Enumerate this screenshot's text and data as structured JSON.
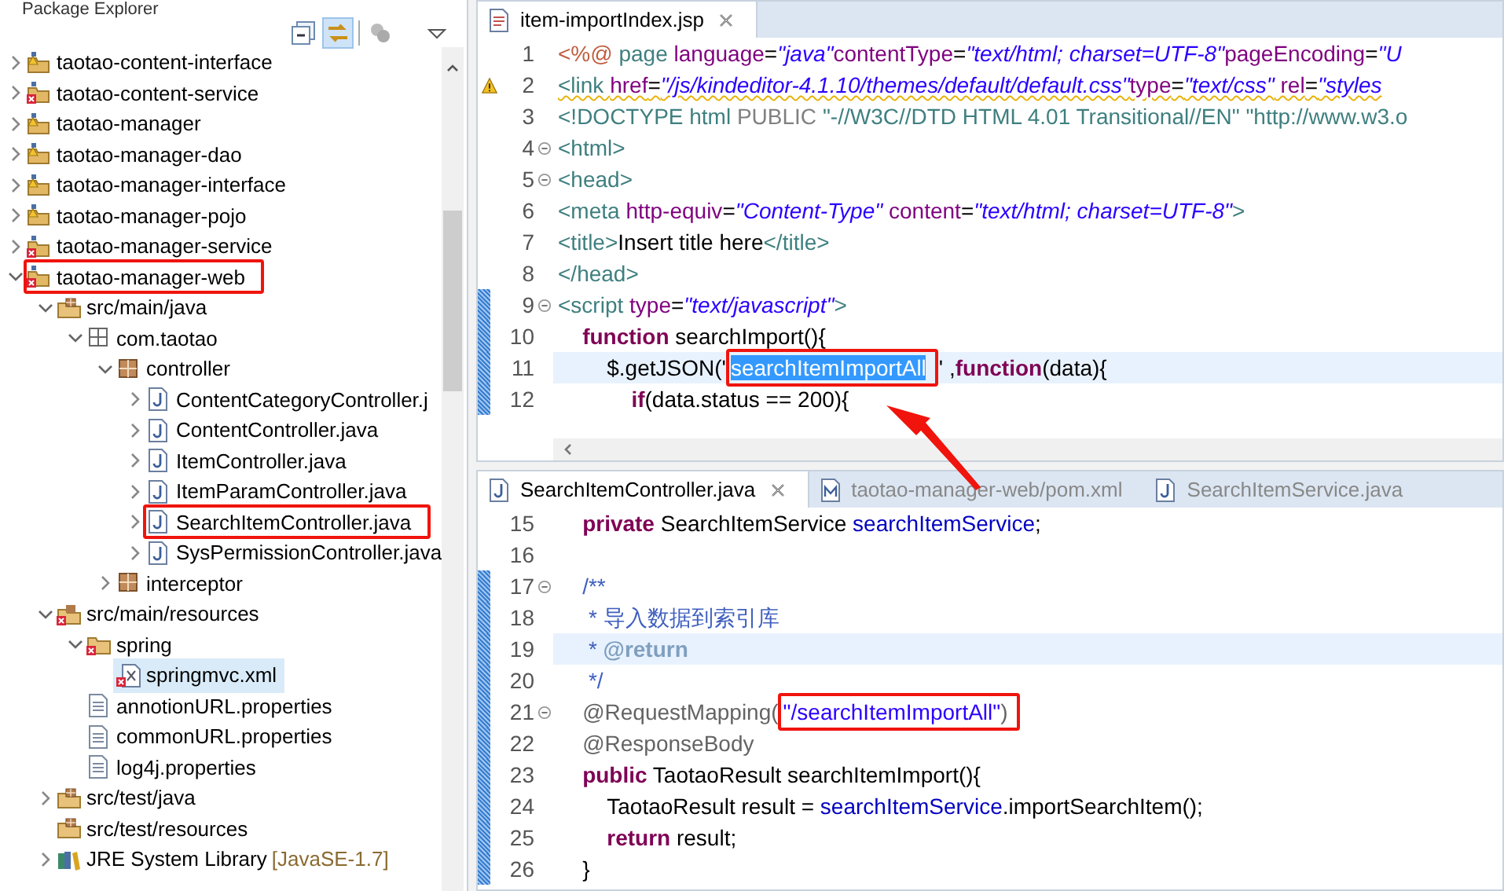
{
  "explorer": {
    "title": "Package Explorer",
    "tree": [
      {
        "label": "taotao-content-interface",
        "kind": "project-warning",
        "expanded": false,
        "selected": false
      },
      {
        "label": "taotao-content-service",
        "kind": "project-error",
        "expanded": false,
        "selected": false
      },
      {
        "label": "taotao-manager",
        "kind": "project-warning",
        "expanded": false,
        "selected": false
      },
      {
        "label": "taotao-manager-dao",
        "kind": "project-warning",
        "expanded": false,
        "selected": false
      },
      {
        "label": "taotao-manager-interface",
        "kind": "project-warning",
        "expanded": false,
        "selected": false
      },
      {
        "label": "taotao-manager-pojo",
        "kind": "project-warning",
        "expanded": false,
        "selected": false
      },
      {
        "label": "taotao-manager-service",
        "kind": "project-error",
        "expanded": false,
        "selected": false
      },
      {
        "label": "taotao-manager-web",
        "kind": "project-error",
        "expanded": true,
        "selected": false,
        "marked": true,
        "children": [
          {
            "label": "src/main/java",
            "kind": "source-folder",
            "expanded": true,
            "selected": false,
            "children": [
              {
                "label": "com.taotao",
                "kind": "package-empty",
                "expanded": true,
                "selected": false,
                "children": [
                  {
                    "label": "controller",
                    "kind": "package",
                    "expanded": true,
                    "selected": false,
                    "children": [
                      {
                        "label": "ContentCategoryController.j",
                        "kind": "java",
                        "expanded": false,
                        "selected": false
                      },
                      {
                        "label": "ContentController.java",
                        "kind": "java",
                        "expanded": false,
                        "selected": false
                      },
                      {
                        "label": "ItemController.java",
                        "kind": "java",
                        "expanded": false,
                        "selected": false
                      },
                      {
                        "label": "ItemParamController.java",
                        "kind": "java",
                        "expanded": false,
                        "selected": false
                      },
                      {
                        "label": "SearchItemController.java",
                        "kind": "java",
                        "expanded": false,
                        "selected": false,
                        "marked": true
                      },
                      {
                        "label": "SysPermissionController.java",
                        "kind": "java",
                        "expanded": false,
                        "selected": false
                      }
                    ]
                  },
                  {
                    "label": "interceptor",
                    "kind": "package",
                    "expanded": false,
                    "selected": false
                  }
                ]
              }
            ]
          },
          {
            "label": "src/main/resources",
            "kind": "source-folder-error",
            "expanded": true,
            "selected": false,
            "children": [
              {
                "label": "spring",
                "kind": "folder-error",
                "expanded": true,
                "selected": false,
                "children": [
                  {
                    "label": "springmvc.xml",
                    "kind": "xml-error",
                    "selected": true
                  }
                ]
              },
              {
                "label": "annotionURL.properties",
                "kind": "properties",
                "selected": false
              },
              {
                "label": "commonURL.properties",
                "kind": "properties",
                "selected": false
              },
              {
                "label": "log4j.properties",
                "kind": "properties",
                "selected": false
              }
            ]
          },
          {
            "label": "src/test/java",
            "kind": "source-folder",
            "expanded": false,
            "selected": false
          },
          {
            "label": "src/test/resources",
            "kind": "source-folder",
            "selected": false
          },
          {
            "label": "JRE System Library",
            "decoration": "[JavaSE-1.7]",
            "kind": "library",
            "expanded": false,
            "selected": false
          }
        ]
      }
    ]
  },
  "editors": [
    {
      "tabs": [
        {
          "label": "item-importIndex.jsp",
          "kind": "jsp",
          "selected": true,
          "closable": true
        }
      ],
      "lines": [
        {
          "number": "1",
          "fold": false,
          "changed": false,
          "current": false,
          "warning": false,
          "tokens": [
            {
              "kind": "jsp",
              "text": "<%@ "
            },
            {
              "kind": "tag",
              "text": "page "
            },
            {
              "kind": "attr",
              "text": "language"
            },
            {
              "kind": "plain",
              "text": "="
            },
            {
              "kind": "string",
              "text": "\"java\""
            },
            {
              "kind": "attr",
              "text": "contentType"
            },
            {
              "kind": "plain",
              "text": "="
            },
            {
              "kind": "string",
              "text": "\"text/html; charset=UTF-8\""
            },
            {
              "kind": "attr",
              "text": "pageEncoding"
            },
            {
              "kind": "plain",
              "text": "="
            },
            {
              "kind": "string",
              "text": "\"U"
            }
          ]
        },
        {
          "number": "2",
          "fold": false,
          "changed": false,
          "current": false,
          "warning": true,
          "tokens": [
            {
              "kind": "tag",
              "text": "<link "
            },
            {
              "kind": "attr",
              "text": "href"
            },
            {
              "kind": "plain",
              "text": "="
            },
            {
              "kind": "string",
              "text": "\"/js/kindeditor-4.1.10/themes/default/default.css\""
            },
            {
              "kind": "attr",
              "text": "type"
            },
            {
              "kind": "plain",
              "text": "="
            },
            {
              "kind": "string",
              "text": "\"text/css\""
            },
            {
              "kind": "attr",
              "text": " rel"
            },
            {
              "kind": "plain",
              "text": "="
            },
            {
              "kind": "string",
              "text": "\"styles"
            }
          ]
        },
        {
          "number": "3",
          "fold": false,
          "changed": false,
          "current": false,
          "warning": false,
          "tokens": [
            {
              "kind": "tag",
              "text": "<!DOCTYPE html "
            },
            {
              "kind": "grey",
              "text": "PUBLIC "
            },
            {
              "kind": "tag",
              "text": "\"-//W3C//DTD HTML 4.01 Transitional//EN\" \"http://www.w3.o"
            }
          ]
        },
        {
          "number": "4",
          "fold": true,
          "changed": false,
          "current": false,
          "warning": false,
          "tokens": [
            {
              "kind": "tag",
              "text": "<html>"
            }
          ]
        },
        {
          "number": "5",
          "fold": true,
          "changed": false,
          "current": false,
          "warning": false,
          "tokens": [
            {
              "kind": "tag",
              "text": "<head>"
            }
          ]
        },
        {
          "number": "6",
          "fold": false,
          "changed": false,
          "current": false,
          "warning": false,
          "tokens": [
            {
              "kind": "tag",
              "text": "<meta "
            },
            {
              "kind": "attr",
              "text": "http-equiv"
            },
            {
              "kind": "plain",
              "text": "="
            },
            {
              "kind": "string",
              "text": "\"Content-Type\""
            },
            {
              "kind": "attr",
              "text": " content"
            },
            {
              "kind": "plain",
              "text": "="
            },
            {
              "kind": "string",
              "text": "\"text/html; charset=UTF-8\""
            },
            {
              "kind": "tag",
              "text": ">"
            }
          ]
        },
        {
          "number": "7",
          "fold": false,
          "changed": false,
          "current": false,
          "warning": false,
          "tokens": [
            {
              "kind": "tag",
              "text": "<title>"
            },
            {
              "kind": "plain",
              "text": "Insert title here"
            },
            {
              "kind": "tag",
              "text": "</title>"
            }
          ]
        },
        {
          "number": "8",
          "fold": false,
          "changed": false,
          "current": false,
          "warning": false,
          "tokens": [
            {
              "kind": "tag",
              "text": "</head>"
            }
          ]
        },
        {
          "number": "9",
          "fold": true,
          "changed": true,
          "current": false,
          "warning": false,
          "tokens": [
            {
              "kind": "tag",
              "text": "<script "
            },
            {
              "kind": "attr",
              "text": "type"
            },
            {
              "kind": "plain",
              "text": "="
            },
            {
              "kind": "string",
              "text": "\"text/javascript\""
            },
            {
              "kind": "tag",
              "text": ">"
            }
          ]
        },
        {
          "number": "10",
          "fold": false,
          "changed": true,
          "current": false,
          "warning": false,
          "tokens": [
            {
              "kind": "keyword",
              "text": "\tfunction"
            },
            {
              "kind": "plain",
              "text": " searchImport(){"
            }
          ]
        },
        {
          "number": "11",
          "fold": false,
          "changed": true,
          "current": true,
          "warning": false,
          "tokens": [
            {
              "kind": "plain",
              "text": "\t\t$.getJSON('"
            },
            {
              "kind": "selection",
              "text": "searchItemImportAll",
              "boxed": true
            },
            {
              "kind": "plain",
              "text": "' ,"
            },
            {
              "kind": "keyword",
              "text": "function"
            },
            {
              "kind": "plain",
              "text": "(data){"
            }
          ]
        },
        {
          "number": "12",
          "fold": false,
          "changed": true,
          "current": false,
          "warning": false,
          "tokens": [
            {
              "kind": "keyword",
              "text": "\t\t\tif"
            },
            {
              "kind": "plain",
              "text": "(data.status == 200){"
            }
          ]
        }
      ]
    },
    {
      "tabs": [
        {
          "label": "SearchItemController.java",
          "kind": "java",
          "selected": true,
          "closable": true
        },
        {
          "label": "taotao-manager-web/pom.xml",
          "kind": "maven",
          "selected": false,
          "closable": false
        },
        {
          "label": "SearchItemService.java",
          "kind": "java",
          "selected": false,
          "closable": false
        }
      ],
      "lines": [
        {
          "number": "15",
          "fold": false,
          "changed": false,
          "current": false,
          "warning": false,
          "tokens": [
            {
              "kind": "keyword",
              "text": "\tprivate"
            },
            {
              "kind": "plain",
              "text": " SearchItemService "
            },
            {
              "kind": "field",
              "text": "searchItemService"
            },
            {
              "kind": "plain",
              "text": ";"
            }
          ]
        },
        {
          "number": "16",
          "fold": false,
          "changed": false,
          "current": false,
          "warning": false
        },
        {
          "number": "17",
          "fold": true,
          "changed": true,
          "current": false,
          "warning": false,
          "tokens": [
            {
              "kind": "doc",
              "text": "\t/**"
            }
          ]
        },
        {
          "number": "18",
          "fold": false,
          "changed": true,
          "current": false,
          "warning": false,
          "tokens": [
            {
              "kind": "doc",
              "text": "\t * 导入数据到索引库"
            }
          ]
        },
        {
          "number": "19",
          "fold": false,
          "changed": true,
          "current": true,
          "warning": false,
          "tokens": [
            {
              "kind": "doc",
              "text": "\t * "
            },
            {
              "kind": "doctag",
              "text": "@return"
            }
          ]
        },
        {
          "number": "20",
          "fold": false,
          "changed": true,
          "current": false,
          "warning": false,
          "tokens": [
            {
              "kind": "doc",
              "text": "\t */"
            }
          ]
        },
        {
          "number": "21",
          "fold": true,
          "changed": true,
          "current": false,
          "warning": false,
          "tokens": [
            {
              "kind": "annotation",
              "text": "\t@RequestMapping("
            },
            {
              "kind": "jstring",
              "text": "\"/searchItemImportAll\"",
              "boxed": true
            },
            {
              "kind": "annotation",
              "text": ")",
              "boxed": true
            }
          ]
        },
        {
          "number": "22",
          "fold": false,
          "changed": true,
          "current": false,
          "warning": false,
          "tokens": [
            {
              "kind": "annotation",
              "text": "\t@ResponseBody"
            }
          ]
        },
        {
          "number": "23",
          "fold": false,
          "changed": true,
          "current": false,
          "warning": false,
          "tokens": [
            {
              "kind": "keyword",
              "text": "\tpublic"
            },
            {
              "kind": "plain",
              "text": " TaotaoResult searchItemImport(){"
            }
          ]
        },
        {
          "number": "24",
          "fold": false,
          "changed": true,
          "current": false,
          "warning": false,
          "tokens": [
            {
              "kind": "plain",
              "text": "\t\tTaotaoResult result = "
            },
            {
              "kind": "field",
              "text": "searchItemService"
            },
            {
              "kind": "plain",
              "text": ".importSearchItem();"
            }
          ]
        },
        {
          "number": "25",
          "fold": false,
          "changed": true,
          "current": false,
          "warning": false,
          "tokens": [
            {
              "kind": "keyword",
              "text": "\t\treturn"
            },
            {
              "kind": "plain",
              "text": " result;"
            }
          ]
        },
        {
          "number": "26",
          "fold": false,
          "changed": true,
          "current": false,
          "warning": false,
          "tokens": [
            {
              "kind": "plain",
              "text": "\t}"
            }
          ]
        }
      ]
    }
  ]
}
